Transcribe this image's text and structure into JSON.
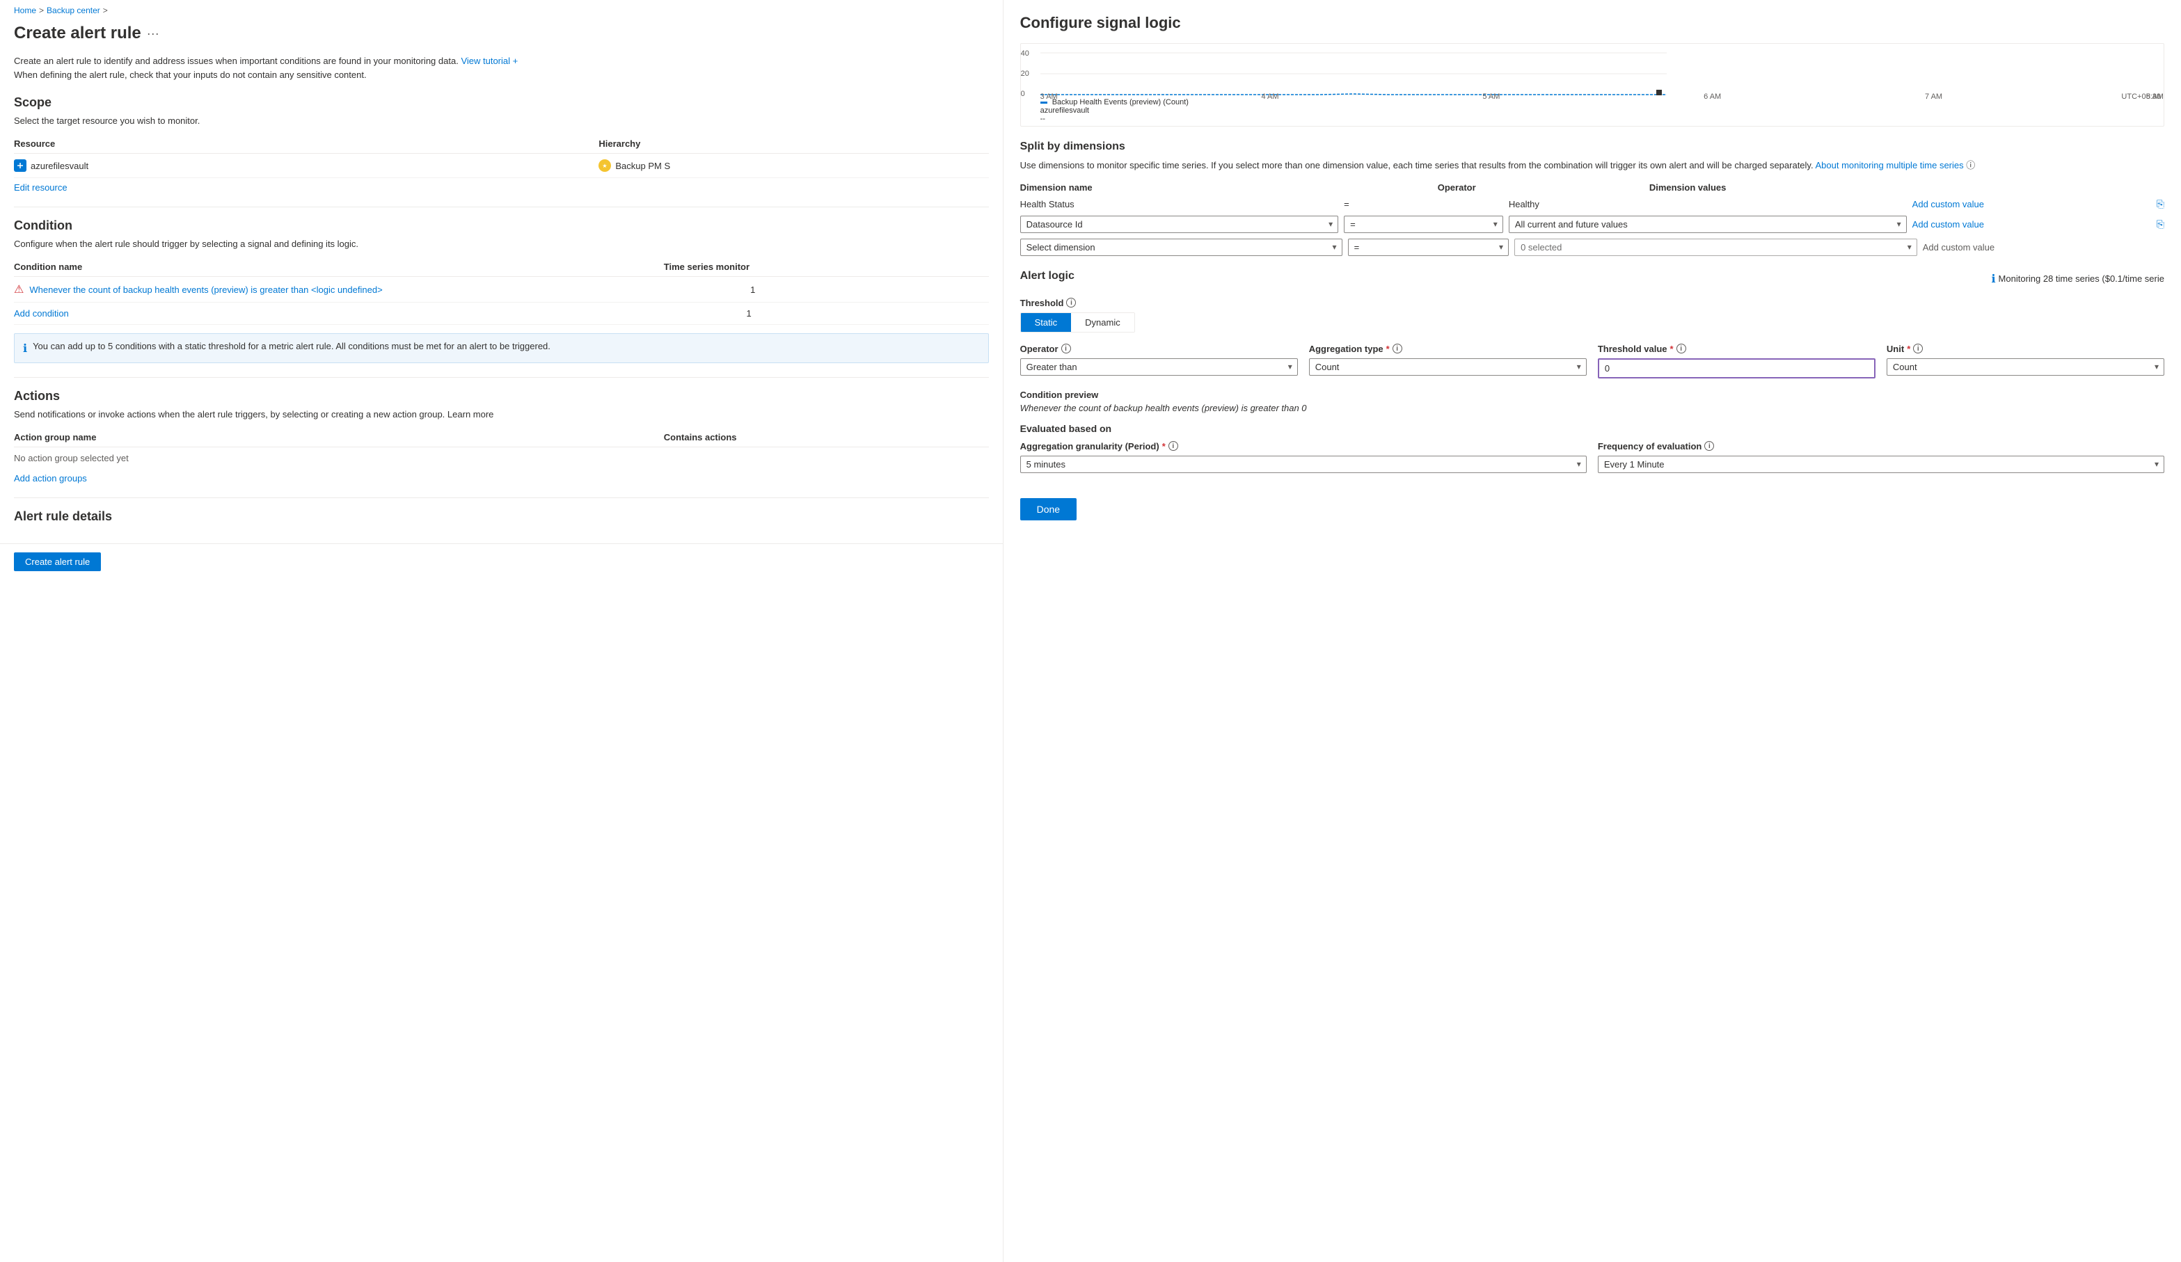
{
  "breadcrumb": {
    "home": "Home",
    "sep1": ">",
    "backup": "Backup center",
    "sep2": ">"
  },
  "left": {
    "page_title": "Create alert rule",
    "more_label": "···",
    "description": "Create an alert rule to identify and address issues when important conditions are found in your monitoring data.",
    "view_tutorial_link": "View tutorial +",
    "sensitive_note": "When defining the alert rule, check that your inputs do not contain any sensitive content.",
    "scope": {
      "title": "Scope",
      "desc": "Select the target resource you wish to monitor.",
      "col_resource": "Resource",
      "col_hierarchy": "Hierarchy",
      "resource_name": "azurefilesvault",
      "hierarchy_name": "Backup PM S",
      "edit_link": "Edit resource"
    },
    "condition": {
      "title": "Condition",
      "desc": "Configure when the alert rule should trigger by selecting a signal and defining its logic.",
      "col_condition": "Condition name",
      "col_timeseries": "Time series monitor",
      "condition_link": "Whenever the count of backup health events (preview) is greater than <logic undefined>",
      "condition_num": "1",
      "add_condition": "Add condition",
      "add_num": "1",
      "info_text": "You can add up to 5 conditions with a static threshold for a metric alert rule. All conditions must be met for an alert to be triggered."
    },
    "actions": {
      "title": "Actions",
      "desc": "Send notifications or invoke actions when the alert rule triggers, by selecting or creating a new action group.",
      "learn_more": "Learn more",
      "col_name": "Action group name",
      "col_contains": "Contains actions",
      "no_action": "No action group selected yet",
      "add_link": "Add action groups"
    },
    "alert_details": {
      "title": "Alert rule details"
    },
    "bottom": {
      "create_btn": "Create alert rule"
    }
  },
  "right": {
    "title": "Configure signal logic",
    "chart": {
      "y_labels": [
        "40",
        "20",
        "0"
      ],
      "x_labels": [
        "3 AM",
        "4 AM",
        "5 AM",
        "6 AM",
        "7 AM",
        "8 AM"
      ],
      "tz": "UTC+05:30",
      "legend_name": "Backup Health Events (preview) (Count)",
      "legend_sub": "azurefilesvault",
      "legend_value": "--"
    },
    "split_dimensions": {
      "title": "Split by dimensions",
      "desc": "Use dimensions to monitor specific time series. If you select more than one dimension value, each time series that results from the combination will trigger its own alert and will be charged separately.",
      "about_link": "About monitoring multiple time series",
      "col_name": "Dimension name",
      "col_op": "Operator",
      "col_val": "Dimension values",
      "static_row": {
        "name": "Health Status",
        "op": "=",
        "val": "Healthy",
        "custom": "Add custom value"
      },
      "select_row1": {
        "name_val": "Datasource Id",
        "op_val": "=",
        "val_val": "All current and future values",
        "custom_link": "Add custom value"
      },
      "select_row2": {
        "name_val": "Select dimension",
        "op_val": "=",
        "val_val": "0 selected",
        "custom_text": "Add custom value"
      }
    },
    "alert_logic": {
      "title": "Alert logic",
      "monitoring_info": "Monitoring 28 time series ($0.1/time serie",
      "threshold_label": "Threshold",
      "static_btn": "Static",
      "dynamic_btn": "Dynamic",
      "operator_label": "Operator",
      "operator_info": "",
      "operator_val": "Greater than",
      "agg_type_label": "Aggregation type",
      "agg_type_required": "*",
      "agg_type_val": "Count",
      "threshold_val_label": "Threshold value",
      "threshold_val_required": "*",
      "threshold_val": "0",
      "unit_label": "Unit",
      "unit_required": "*",
      "unit_val": "Count",
      "condition_preview_title": "Condition preview",
      "condition_preview_text": "Whenever the count of backup health events (preview) is greater than 0"
    },
    "evaluated": {
      "title": "Evaluated based on",
      "agg_granularity_label": "Aggregation granularity (Period)",
      "agg_granularity_required": "*",
      "agg_granularity_val": "5 minutes",
      "freq_label": "Frequency of evaluation",
      "freq_info": "",
      "freq_val": "Every 1 Minute"
    },
    "done_btn": "Done"
  }
}
